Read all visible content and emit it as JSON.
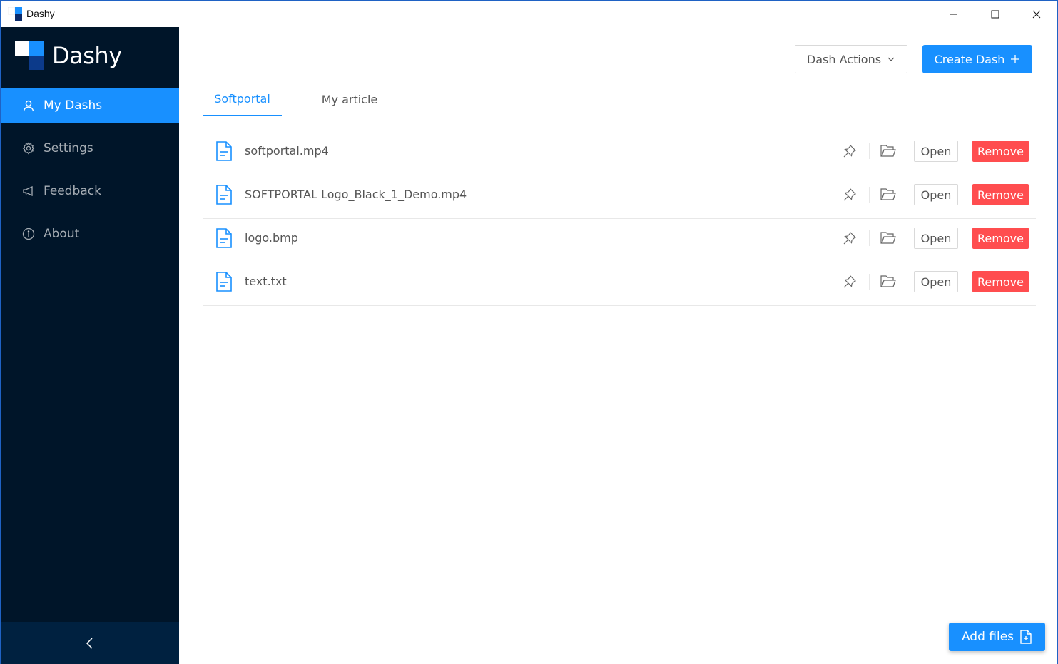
{
  "window": {
    "title": "Dashy"
  },
  "sidebar": {
    "brand": "Dashy",
    "items": [
      {
        "label": "My Dashs",
        "icon": "user-icon",
        "active": true
      },
      {
        "label": "Settings",
        "icon": "gear-icon",
        "active": false
      },
      {
        "label": "Feedback",
        "icon": "megaphone-icon",
        "active": false
      },
      {
        "label": "About",
        "icon": "info-icon",
        "active": false
      }
    ]
  },
  "header": {
    "actions_label": "Dash Actions",
    "create_label": "Create Dash"
  },
  "tabs": [
    {
      "label": "Softportal",
      "active": true
    },
    {
      "label": "My article",
      "active": false
    }
  ],
  "files": [
    {
      "name": "softportal.mp4",
      "open_label": "Open",
      "remove_label": "Remove"
    },
    {
      "name": "SOFTPORTAL Logo_Black_1_Demo.mp4",
      "open_label": "Open",
      "remove_label": "Remove"
    },
    {
      "name": "logo.bmp",
      "open_label": "Open",
      "remove_label": "Remove"
    },
    {
      "name": "text.txt",
      "open_label": "Open",
      "remove_label": "Remove"
    }
  ],
  "footer": {
    "add_files_label": "Add files"
  },
  "colors": {
    "primary": "#1890ff",
    "danger": "#ff4d4f",
    "sidebar_bg": "#001529",
    "sidebar_footer_bg": "#002140"
  }
}
